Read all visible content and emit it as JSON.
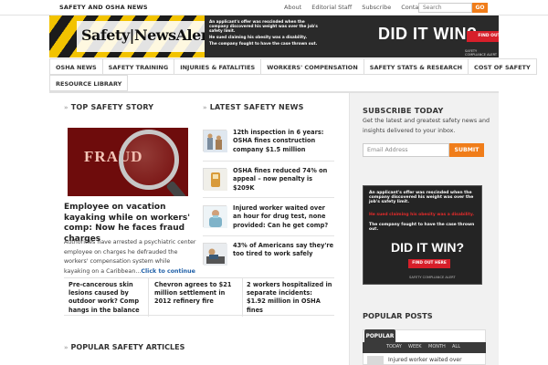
{
  "topbar": {
    "brand": "SAFETY AND OSHA NEWS",
    "links": [
      "About",
      "Editorial Staff",
      "Subscribe",
      "Contact"
    ],
    "search_placeholder": "Search",
    "go_label": "GO"
  },
  "banner": {
    "logo_text": "Safety|NewsAlert",
    "lines": [
      "An applicant's offer was rescinded when the company discovered his weight was over the job's safety limit.",
      "He sued claiming his obesity was a disability.",
      "The company fought to have the case thrown out."
    ],
    "headline": "DID IT WIN?",
    "cta": "FIND OUT HERE",
    "footer": "SAFETY COMPLIANCE ALERT"
  },
  "nav": {
    "row1": [
      "OSHA NEWS",
      "SAFETY TRAINING",
      "INJURIES & FATALITIES",
      "WORKERS' COMPENSATION",
      "SAFETY STATS & RESEARCH",
      "COST OF SAFETY"
    ],
    "row2": [
      "RESOURCE LIBRARY"
    ]
  },
  "top_story": {
    "section_title": "TOP SAFETY STORY",
    "image_word": "FRAUD",
    "headline": "Employee on vacation kayaking while on workers' comp: Now he faces fraud charges",
    "description": "Authorities have arrested a psychiatric center employee on charges he defrauded the workers' compensation system while kayaking on a Caribbean...",
    "more": "Click to continue"
  },
  "latest_news": {
    "section_title": "LATEST SAFETY NEWS",
    "items": [
      "12th inspection in 6 years: OSHA fines construction company $1.5 million",
      "OSHA fines reduced 74% on appeal – now penalty is $209K",
      "Injured worker waited over an hour for drug test, none provided: Can he get comp?",
      "43% of Americans say they're too tired to work safely"
    ]
  },
  "bottom_strip": [
    "Pre-cancerous skin lesions caused by outdoor work? Comp hangs in the balance",
    "Chevron agrees to $21 million settlement in 2012 refinery fire",
    "2 workers hospitalized in separate incidents: $1.92 million in OSHA fines"
  ],
  "popular_articles": {
    "title": "POPULAR SAFETY ARTICLES"
  },
  "sidebar": {
    "subscribe_title": "SUBSCRIBE TODAY",
    "subscribe_desc": "Get the latest and greatest safety news and insights delivered to your inbox.",
    "email_placeholder": "Email Address",
    "submit_label": "SUBMIT",
    "ad": {
      "lines": [
        "An applicant's offer was rescinded when the company discovered his weight was over the job's safety limit.",
        "He sued claiming his obesity was a disability.",
        "The company fought to have the case thrown out."
      ],
      "headline": "DID IT WIN?",
      "cta": "FIND OUT HERE",
      "footer": "SAFETY COMPLIANCE ALERT"
    },
    "popular_posts_title": "POPULAR POSTS",
    "popular_tab": "POPULAR",
    "period_tabs": [
      "TODAY",
      "WEEK",
      "MONTH",
      "ALL"
    ],
    "first_post": "Injured worker waited over"
  },
  "colors": {
    "accent": "#f07d1a",
    "link": "#1d5ea7",
    "cta_red": "#d71f2a",
    "stripe_yellow": "#f2c300"
  }
}
